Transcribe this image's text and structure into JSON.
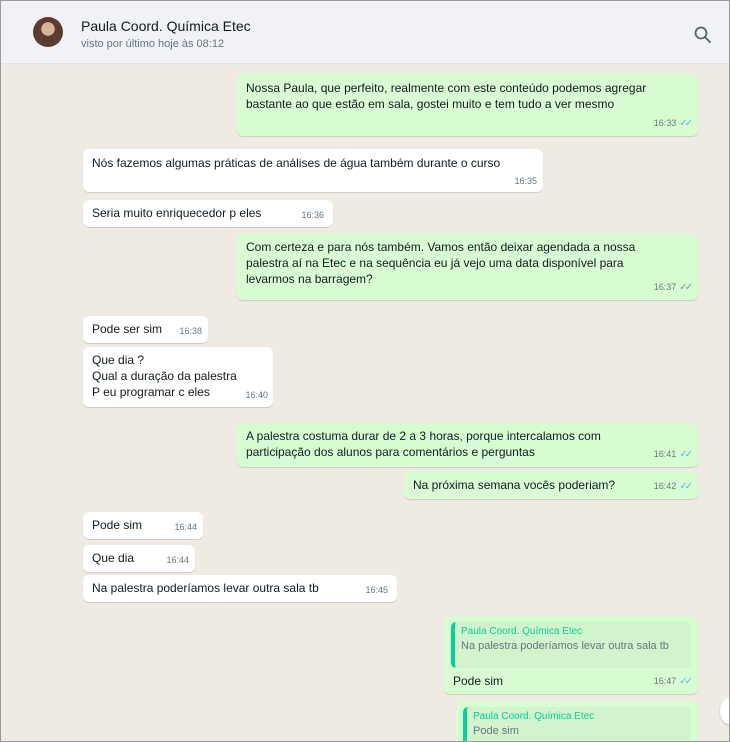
{
  "header": {
    "contact_name": "Paula Coord. Química Etec",
    "status": "visto por último hoje às 08:12"
  },
  "messages": [
    {
      "text": "Nossa Paula, que perfeito, realmente com este conteúdo podemos agregar\nbastante ao que estão em sala, gostei muito e tem tudo a ver mesmo",
      "time": "16:33"
    },
    {
      "text": "Nós fazemos algumas práticas de análises de água também durante o curso",
      "time": "16:35"
    },
    {
      "text": "Seria muito enriquecedor p eles",
      "time": "16:36"
    },
    {
      "text": "Com certeza e para nós também. Vamos então deixar agendada a nossa\npalestra aí na Etec e na sequência eu já vejo uma data disponível para\nlevarmos na barragem?",
      "time": "16:37"
    },
    {
      "text": "Pode ser sim",
      "time": "16:38"
    },
    {
      "text": "Que dia ?\nQual a duração da palestra\nP eu programar c eles",
      "time": "16:40"
    },
    {
      "text": "A palestra costuma durar de 2 a 3 horas, porque intercalamos com\nparticipação dos alunos para comentários e perguntas",
      "time": "16:41"
    },
    {
      "text": "Na próxima semana vocês poderiam?",
      "time": "16:42"
    },
    {
      "text": "Pode sim",
      "time": "16:44"
    },
    {
      "text": "Que dia",
      "time": "16:44"
    },
    {
      "text": "Na palestra poderíamos levar outra sala tb",
      "time": "16:45"
    },
    {
      "text": "Pode sim",
      "time": "16:47",
      "quote": {
        "author": "Paula Coord. Química Etec",
        "text": "Na palestra poderíamos levar outra sala tb"
      }
    },
    {
      "quote": {
        "author": "Paula Coord. Química Etec",
        "text": "Pode sim"
      }
    }
  ]
}
